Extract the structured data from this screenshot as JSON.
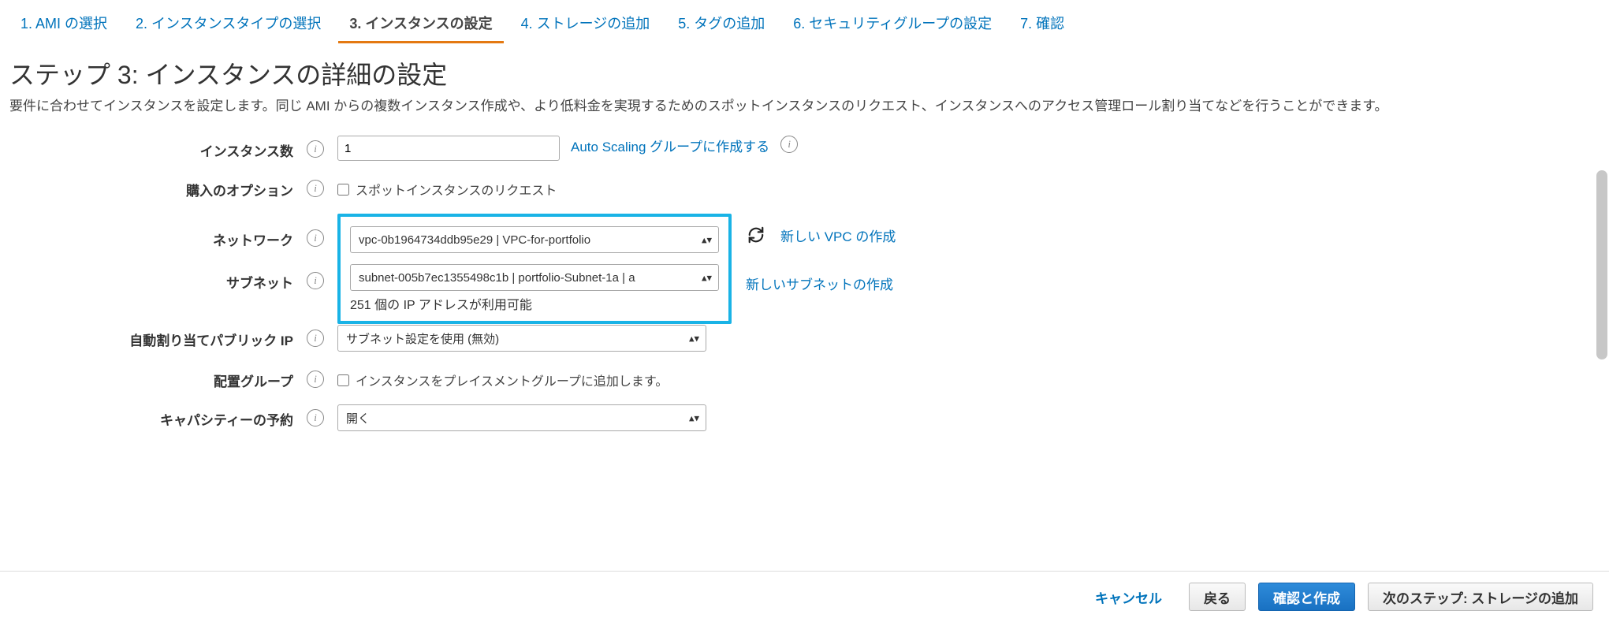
{
  "steps": [
    "1. AMI の選択",
    "2. インスタンスタイプの選択",
    "3. インスタンスの設定",
    "4. ストレージの追加",
    "5. タグの追加",
    "6. セキュリティグループの設定",
    "7. 確認"
  ],
  "activeStep": 2,
  "title": "ステップ 3: インスタンスの詳細の設定",
  "desc": "要件に合わせてインスタンスを設定します。同じ AMI からの複数インスタンス作成や、より低料金を実現するためのスポットインスタンスのリクエスト、インスタンスへのアクセス管理ロール割り当てなどを行うことができます。",
  "fields": {
    "instanceCount": {
      "label": "インスタンス数",
      "value": "1",
      "autoScalingLink": "Auto Scaling グループに作成する"
    },
    "purchase": {
      "label": "購入のオプション",
      "checkboxLabel": "スポットインスタンスのリクエスト"
    },
    "network": {
      "label": "ネットワーク",
      "value": "vpc-0b1964734ddb95e29 | VPC-for-portfolio",
      "createLink": "新しい VPC の作成"
    },
    "subnet": {
      "label": "サブネット",
      "value": "subnet-005b7ec1355498c1b | portfolio-Subnet-1a | a",
      "ipInfo": "251 個の IP アドレスが利用可能",
      "createLink": "新しいサブネットの作成"
    },
    "publicIp": {
      "label": "自動割り当てパブリック IP",
      "value": "サブネット設定を使用 (無効)"
    },
    "placement": {
      "label": "配置グループ",
      "checkboxLabel": "インスタンスをプレイスメントグループに追加します。"
    },
    "capacity": {
      "label": "キャパシティーの予約",
      "value": "開く"
    }
  },
  "footer": {
    "cancel": "キャンセル",
    "back": "戻る",
    "reviewLaunch": "確認と作成",
    "next": "次のステップ: ストレージの追加"
  }
}
